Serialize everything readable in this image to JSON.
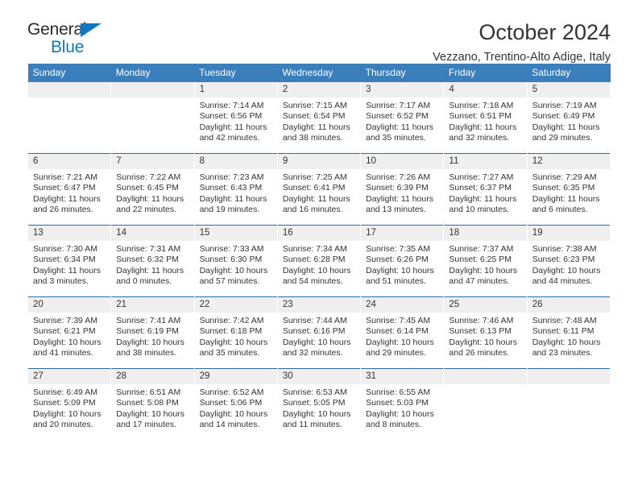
{
  "brand": {
    "name_part1": "General",
    "name_part2": "Blue",
    "accent_color": "#1277bf"
  },
  "header": {
    "title": "October 2024",
    "subtitle": "Vezzano, Trentino-Alto Adige, Italy",
    "header_bg_color": "#3b7ebc",
    "daynum_bg_color": "#efefef",
    "row_separator_color": "#2e6da4"
  },
  "weekday_headers": [
    "Sunday",
    "Monday",
    "Tuesday",
    "Wednesday",
    "Thursday",
    "Friday",
    "Saturday"
  ],
  "weeks": [
    [
      {
        "day": "",
        "sunrise": "",
        "sunset": "",
        "daylight": "",
        "empty": true
      },
      {
        "day": "",
        "sunrise": "",
        "sunset": "",
        "daylight": "",
        "empty": true
      },
      {
        "day": "1",
        "sunrise": "Sunrise: 7:14 AM",
        "sunset": "Sunset: 6:56 PM",
        "daylight": "Daylight: 11 hours and 42 minutes."
      },
      {
        "day": "2",
        "sunrise": "Sunrise: 7:15 AM",
        "sunset": "Sunset: 6:54 PM",
        "daylight": "Daylight: 11 hours and 38 minutes."
      },
      {
        "day": "3",
        "sunrise": "Sunrise: 7:17 AM",
        "sunset": "Sunset: 6:52 PM",
        "daylight": "Daylight: 11 hours and 35 minutes."
      },
      {
        "day": "4",
        "sunrise": "Sunrise: 7:18 AM",
        "sunset": "Sunset: 6:51 PM",
        "daylight": "Daylight: 11 hours and 32 minutes."
      },
      {
        "day": "5",
        "sunrise": "Sunrise: 7:19 AM",
        "sunset": "Sunset: 6:49 PM",
        "daylight": "Daylight: 11 hours and 29 minutes."
      }
    ],
    [
      {
        "day": "6",
        "sunrise": "Sunrise: 7:21 AM",
        "sunset": "Sunset: 6:47 PM",
        "daylight": "Daylight: 11 hours and 26 minutes."
      },
      {
        "day": "7",
        "sunrise": "Sunrise: 7:22 AM",
        "sunset": "Sunset: 6:45 PM",
        "daylight": "Daylight: 11 hours and 22 minutes."
      },
      {
        "day": "8",
        "sunrise": "Sunrise: 7:23 AM",
        "sunset": "Sunset: 6:43 PM",
        "daylight": "Daylight: 11 hours and 19 minutes."
      },
      {
        "day": "9",
        "sunrise": "Sunrise: 7:25 AM",
        "sunset": "Sunset: 6:41 PM",
        "daylight": "Daylight: 11 hours and 16 minutes."
      },
      {
        "day": "10",
        "sunrise": "Sunrise: 7:26 AM",
        "sunset": "Sunset: 6:39 PM",
        "daylight": "Daylight: 11 hours and 13 minutes."
      },
      {
        "day": "11",
        "sunrise": "Sunrise: 7:27 AM",
        "sunset": "Sunset: 6:37 PM",
        "daylight": "Daylight: 11 hours and 10 minutes."
      },
      {
        "day": "12",
        "sunrise": "Sunrise: 7:29 AM",
        "sunset": "Sunset: 6:35 PM",
        "daylight": "Daylight: 11 hours and 6 minutes."
      }
    ],
    [
      {
        "day": "13",
        "sunrise": "Sunrise: 7:30 AM",
        "sunset": "Sunset: 6:34 PM",
        "daylight": "Daylight: 11 hours and 3 minutes."
      },
      {
        "day": "14",
        "sunrise": "Sunrise: 7:31 AM",
        "sunset": "Sunset: 6:32 PM",
        "daylight": "Daylight: 11 hours and 0 minutes."
      },
      {
        "day": "15",
        "sunrise": "Sunrise: 7:33 AM",
        "sunset": "Sunset: 6:30 PM",
        "daylight": "Daylight: 10 hours and 57 minutes."
      },
      {
        "day": "16",
        "sunrise": "Sunrise: 7:34 AM",
        "sunset": "Sunset: 6:28 PM",
        "daylight": "Daylight: 10 hours and 54 minutes."
      },
      {
        "day": "17",
        "sunrise": "Sunrise: 7:35 AM",
        "sunset": "Sunset: 6:26 PM",
        "daylight": "Daylight: 10 hours and 51 minutes."
      },
      {
        "day": "18",
        "sunrise": "Sunrise: 7:37 AM",
        "sunset": "Sunset: 6:25 PM",
        "daylight": "Daylight: 10 hours and 47 minutes."
      },
      {
        "day": "19",
        "sunrise": "Sunrise: 7:38 AM",
        "sunset": "Sunset: 6:23 PM",
        "daylight": "Daylight: 10 hours and 44 minutes."
      }
    ],
    [
      {
        "day": "20",
        "sunrise": "Sunrise: 7:39 AM",
        "sunset": "Sunset: 6:21 PM",
        "daylight": "Daylight: 10 hours and 41 minutes."
      },
      {
        "day": "21",
        "sunrise": "Sunrise: 7:41 AM",
        "sunset": "Sunset: 6:19 PM",
        "daylight": "Daylight: 10 hours and 38 minutes."
      },
      {
        "day": "22",
        "sunrise": "Sunrise: 7:42 AM",
        "sunset": "Sunset: 6:18 PM",
        "daylight": "Daylight: 10 hours and 35 minutes."
      },
      {
        "day": "23",
        "sunrise": "Sunrise: 7:44 AM",
        "sunset": "Sunset: 6:16 PM",
        "daylight": "Daylight: 10 hours and 32 minutes."
      },
      {
        "day": "24",
        "sunrise": "Sunrise: 7:45 AM",
        "sunset": "Sunset: 6:14 PM",
        "daylight": "Daylight: 10 hours and 29 minutes."
      },
      {
        "day": "25",
        "sunrise": "Sunrise: 7:46 AM",
        "sunset": "Sunset: 6:13 PM",
        "daylight": "Daylight: 10 hours and 26 minutes."
      },
      {
        "day": "26",
        "sunrise": "Sunrise: 7:48 AM",
        "sunset": "Sunset: 6:11 PM",
        "daylight": "Daylight: 10 hours and 23 minutes."
      }
    ],
    [
      {
        "day": "27",
        "sunrise": "Sunrise: 6:49 AM",
        "sunset": "Sunset: 5:09 PM",
        "daylight": "Daylight: 10 hours and 20 minutes."
      },
      {
        "day": "28",
        "sunrise": "Sunrise: 6:51 AM",
        "sunset": "Sunset: 5:08 PM",
        "daylight": "Daylight: 10 hours and 17 minutes."
      },
      {
        "day": "29",
        "sunrise": "Sunrise: 6:52 AM",
        "sunset": "Sunset: 5:06 PM",
        "daylight": "Daylight: 10 hours and 14 minutes."
      },
      {
        "day": "30",
        "sunrise": "Sunrise: 6:53 AM",
        "sunset": "Sunset: 5:05 PM",
        "daylight": "Daylight: 10 hours and 11 minutes."
      },
      {
        "day": "31",
        "sunrise": "Sunrise: 6:55 AM",
        "sunset": "Sunset: 5:03 PM",
        "daylight": "Daylight: 10 hours and 8 minutes."
      },
      {
        "day": "",
        "sunrise": "",
        "sunset": "",
        "daylight": "",
        "empty": true
      },
      {
        "day": "",
        "sunrise": "",
        "sunset": "",
        "daylight": "",
        "empty": true
      }
    ]
  ]
}
